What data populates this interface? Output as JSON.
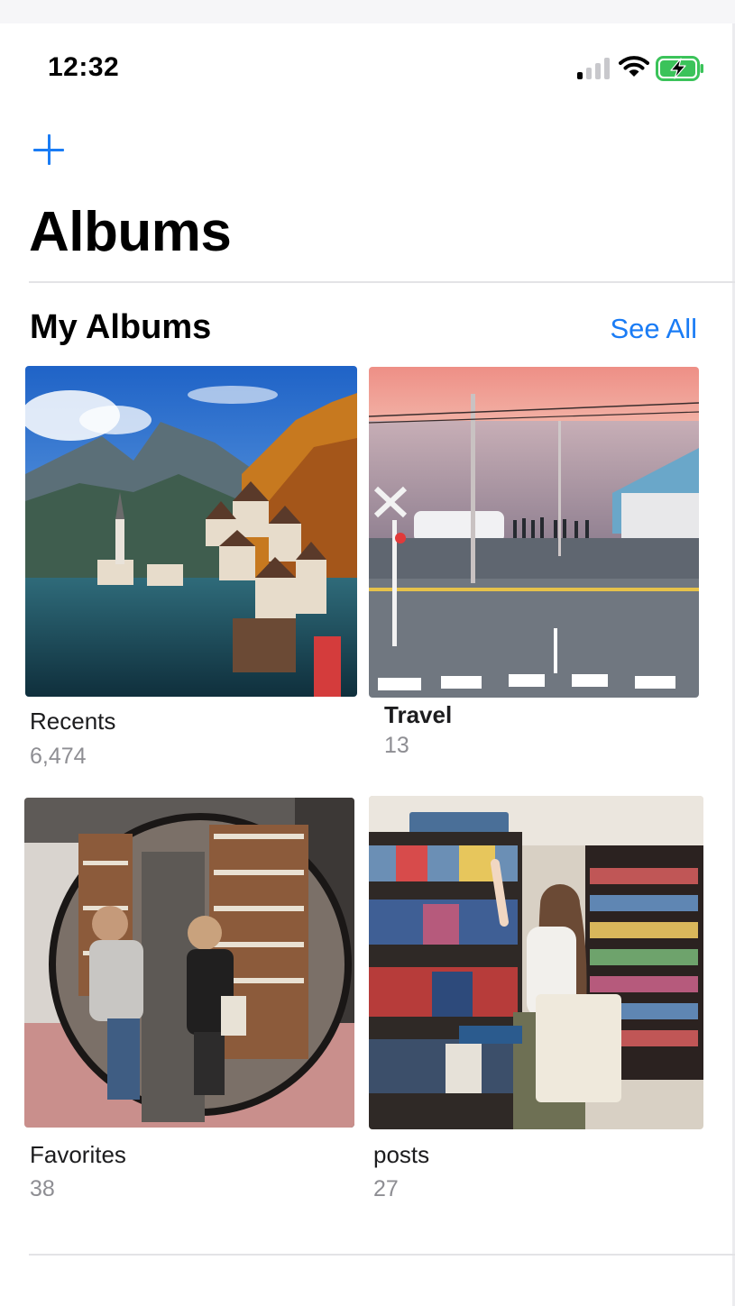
{
  "status": {
    "time": "12:32",
    "signal_bars": 1,
    "battery": "charging"
  },
  "nav": {
    "add_icon": "plus-icon"
  },
  "page": {
    "title": "Albums"
  },
  "section": {
    "title": "My Albums",
    "see_all": "See All"
  },
  "albums": [
    {
      "name": "Recents",
      "count": "6,474"
    },
    {
      "name": "Travel",
      "count": "13"
    },
    {
      "name": "Favorites",
      "count": "38"
    },
    {
      "name": "posts",
      "count": "27"
    }
  ],
  "colors": {
    "accent": "#1a7cf5",
    "secondary_text": "#8e8e93",
    "separator": "#e3e3e6"
  }
}
